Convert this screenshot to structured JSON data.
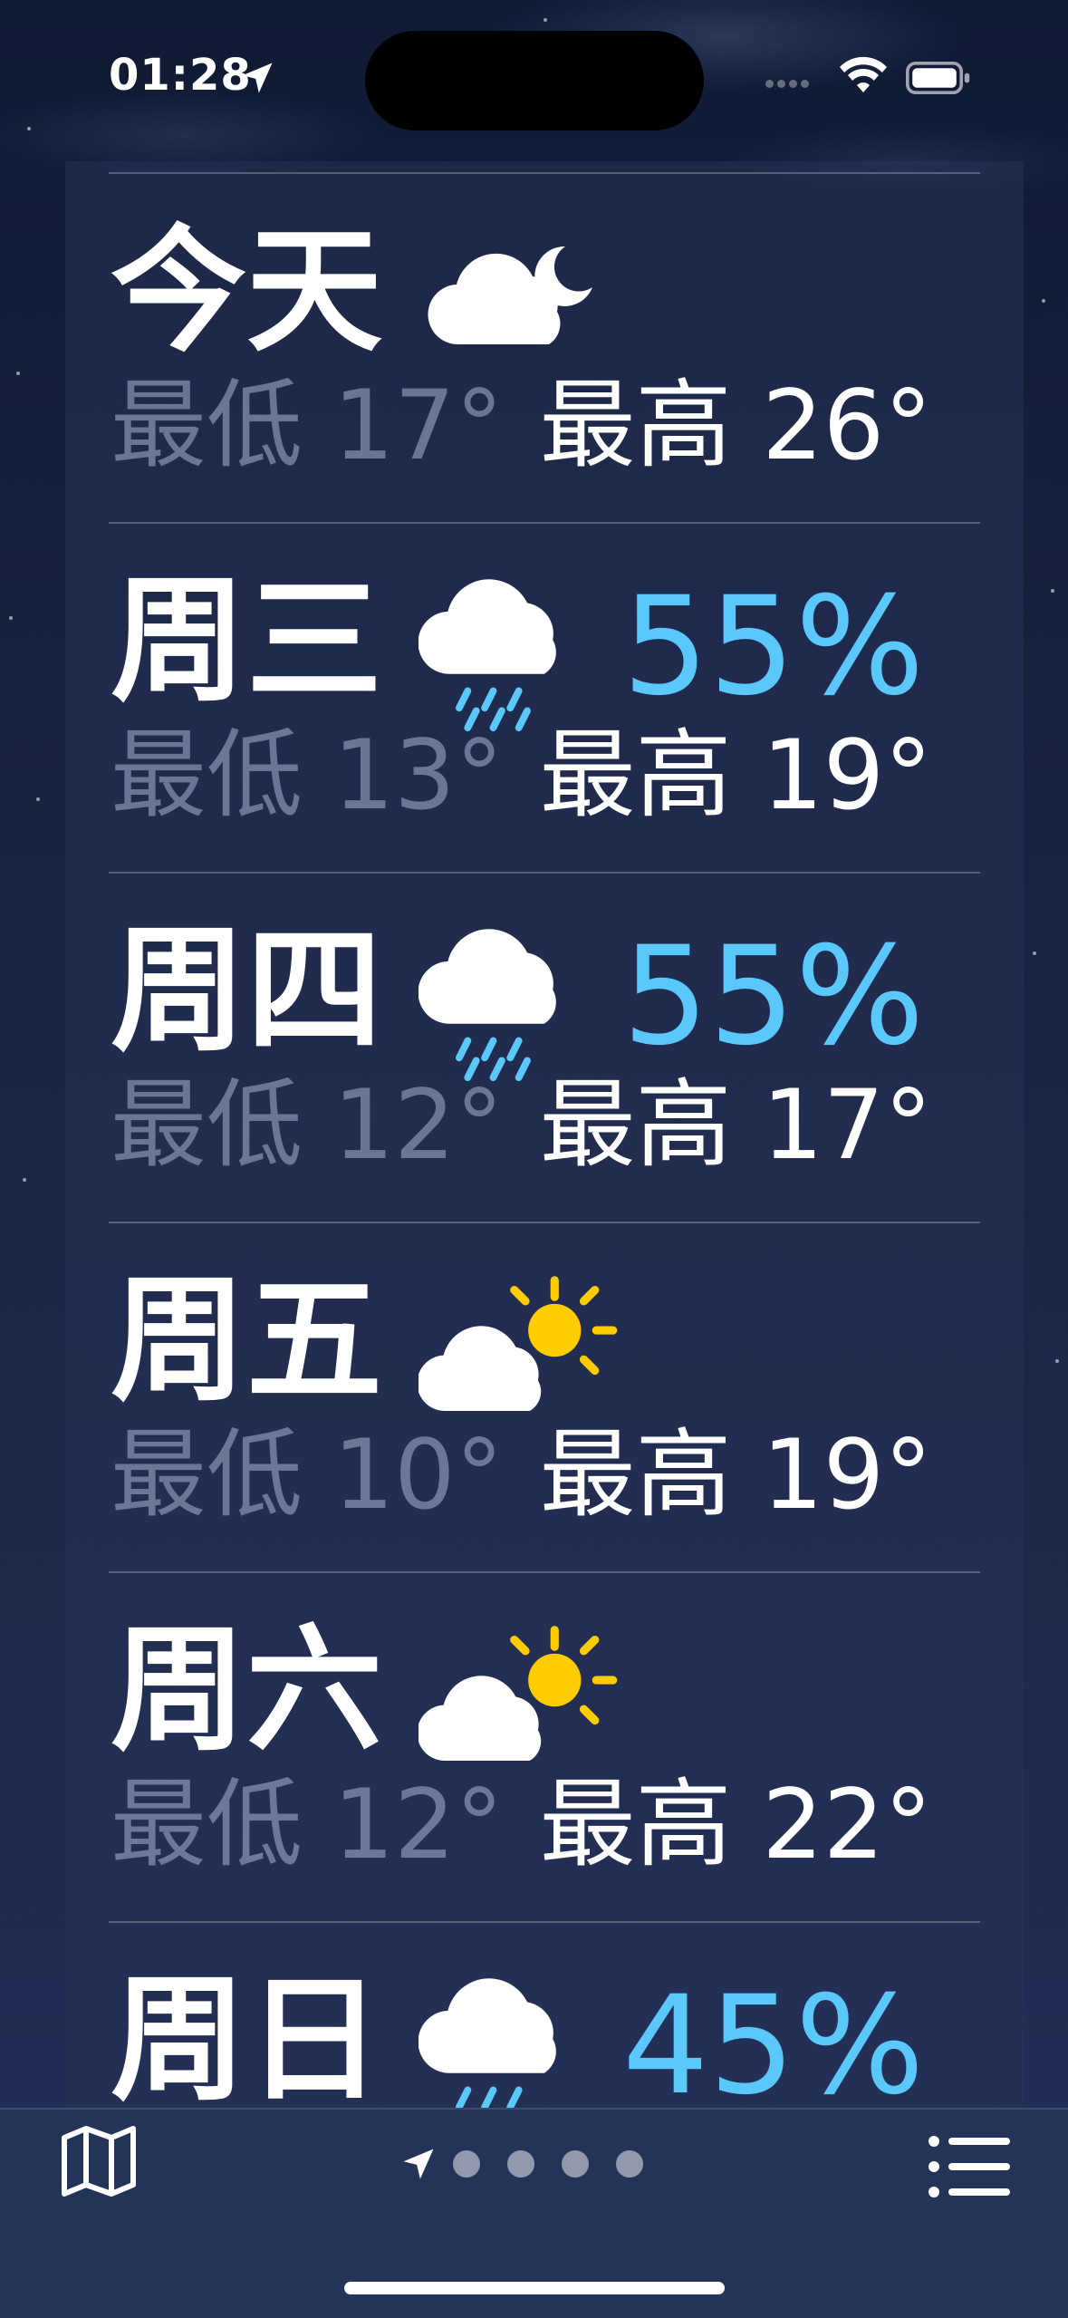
{
  "status_bar": {
    "time": "01:28"
  },
  "forecast": [
    {
      "day": "今天",
      "condition_icon": "partly-cloudy-night-icon",
      "precip": "",
      "low": "最低 17°",
      "high": "最高 26°"
    },
    {
      "day": "周三",
      "condition_icon": "rain-icon",
      "precip": "55%",
      "low": "最低 13°",
      "high": "最高 19°"
    },
    {
      "day": "周四",
      "condition_icon": "rain-icon",
      "precip": "55%",
      "low": "最低 12°",
      "high": "最高 17°"
    },
    {
      "day": "周五",
      "condition_icon": "partly-sunny-icon",
      "precip": "",
      "low": "最低 10°",
      "high": "最高 19°"
    },
    {
      "day": "周六",
      "condition_icon": "partly-sunny-icon",
      "precip": "",
      "low": "最低 12°",
      "high": "最高 22°"
    },
    {
      "day": "周日",
      "condition_icon": "rain-icon",
      "precip": "45%",
      "low": "",
      "high": ""
    }
  ],
  "toolbar": {
    "left_icon": "map-icon",
    "right_icon": "list-icon",
    "page_indicator_count": 4
  },
  "colors": {
    "precip": "#5ac8fa",
    "sun": "#ffcc00",
    "background": "#17223f"
  }
}
